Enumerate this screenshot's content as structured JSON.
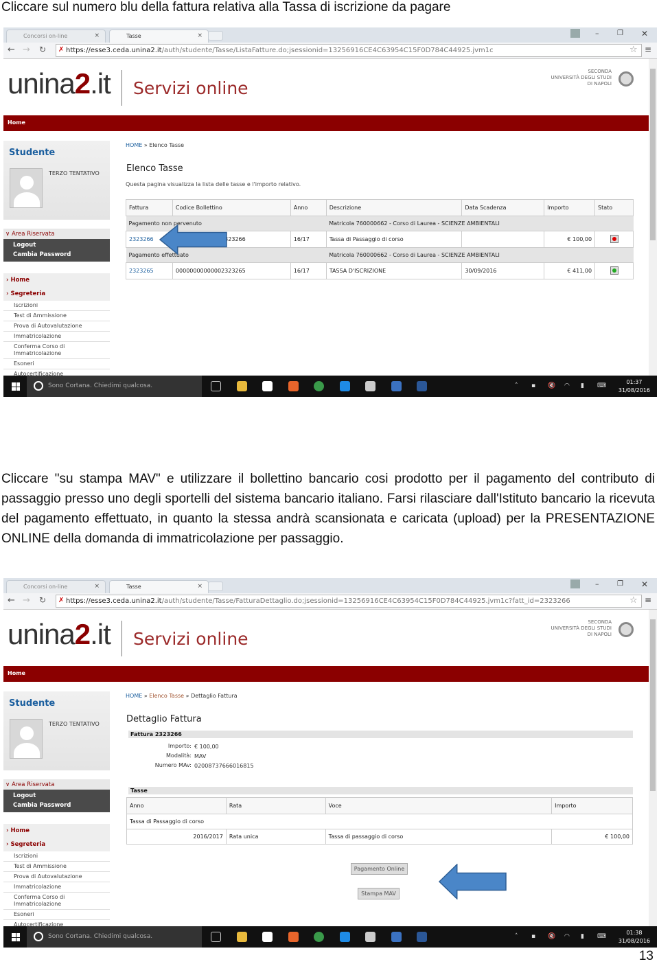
{
  "instructions": [
    "Cliccare sul numero blu della fattura relativa alla Tassa di iscrizione da pagare",
    "Cliccare \"su stampa MAV\" e utilizzare il bollettino bancario cosi prodotto per il pagamento del contributo di passaggio presso uno degli sportelli del sistema bancario italiano. Farsi rilasciare dall'Istituto bancario la ricevuta del pagamento effettuato, in quanto la stessa andrà scansionata e caricata (upload) per la PRESENTAZIONE ONLINE della domanda di immatricolazione per passaggio."
  ],
  "page_number": "13",
  "portal": {
    "logo": {
      "a": "unina",
      "b": "2",
      "c": ".it"
    },
    "service": "Servizi online",
    "university": [
      "SECONDA",
      "UNIVERSITÀ DEGLI STUDI",
      "DI NAPOLI"
    ],
    "nav_home": "Home",
    "sidebar": {
      "title": "Studente",
      "name": "TERZO TENTATIVO",
      "area_riservata": "Area Riservata",
      "area_links": [
        "Logout",
        "Cambia Password"
      ],
      "menu_main": [
        "Home",
        "Segreteria"
      ],
      "menu_sub": [
        "Iscrizioni",
        "Test di Ammissione",
        "Prova di Autovalutazione",
        "Immatricolazione",
        "Conferma Corso di Immatricolazione",
        "Esoneri",
        "Autocertificazione"
      ]
    },
    "brand_color": "#8b0000",
    "link_color": "#1a5e9e"
  },
  "screens": [
    {
      "tabs": [
        "Concorsi on-line",
        "Tasse"
      ],
      "url_host": "https://esse3.ceda.unina2.it",
      "url_path": "/auth/studente/Tasse/ListaFatture.do;jsessionid=13256916CE4C63954C15F0D784C44925.jvm1c",
      "breadcrumb": [
        "HOME",
        "Elenco Tasse"
      ],
      "title": "Elenco Tasse",
      "description": "Questa pagina visualizza la lista delle tasse e l'importo relativo.",
      "table": {
        "headers": [
          "Fattura",
          "Codice Bollettino",
          "Anno",
          "Descrizione",
          "Data Scadenza",
          "Importo",
          "Stato"
        ],
        "groups": [
          {
            "status": "Pagamento non pervenuto",
            "matricola": "Matricola 760000662 - Corso di Laurea - SCIENZE AMBIENTALI",
            "row": {
              "fattura": "2323266",
              "codice": "00000000000002323266",
              "anno": "16/17",
              "descrizione": "Tassa di Passaggio di corso",
              "scadenza": "",
              "importo": "€ 100,00",
              "stato": "red"
            }
          },
          {
            "status": "Pagamento effettuato",
            "matricola": "Matricola 760000662 - Corso di Laurea - SCIENZE AMBIENTALI",
            "row": {
              "fattura": "2323265",
              "codice": "00000000000002323265",
              "anno": "16/17",
              "descrizione": "TASSA D'ISCRIZIONE",
              "scadenza": "30/09/2016",
              "importo": "€ 411,00",
              "stato": "green"
            }
          }
        ]
      },
      "taskbar": {
        "search": "Sono Cortana. Chiedimi qualcosa.",
        "time": "01:37",
        "date": "31/08/2016"
      }
    },
    {
      "tabs": [
        "Concorsi on-line",
        "Tasse"
      ],
      "url_host": "https://esse3.ceda.unina2.it",
      "url_path": "/auth/studente/Tasse/FatturaDettaglio.do;jsessionid=13256916CE4C63954C15F0D784C44925.jvm1c?fatt_id=2323266",
      "breadcrumb": [
        "HOME",
        "Elenco Tasse",
        "Dettaglio Fattura"
      ],
      "title": "Dettaglio Fattura",
      "fattura_label": "Fattura 2323266",
      "details": [
        {
          "label": "Importo:",
          "value": "€ 100,00"
        },
        {
          "label": "Modalità:",
          "value": "MAV"
        },
        {
          "label": "Numero MAv:",
          "value": "02008737666016815"
        }
      ],
      "tasse_label": "Tasse",
      "tasse_table": {
        "headers": [
          "Anno",
          "Rata",
          "Voce",
          "Importo"
        ],
        "group": "Tassa di Passaggio di corso",
        "row": [
          "2016/2017",
          "Rata unica",
          "Tassa di passaggio di corso",
          "€ 100,00"
        ]
      },
      "buttons": {
        "online": "Pagamento Online",
        "mav": "Stampa MAV"
      },
      "taskbar": {
        "search": "Sono Cortana. Chiedimi qualcosa.",
        "time": "01:38",
        "date": "31/08/2016"
      }
    }
  ]
}
